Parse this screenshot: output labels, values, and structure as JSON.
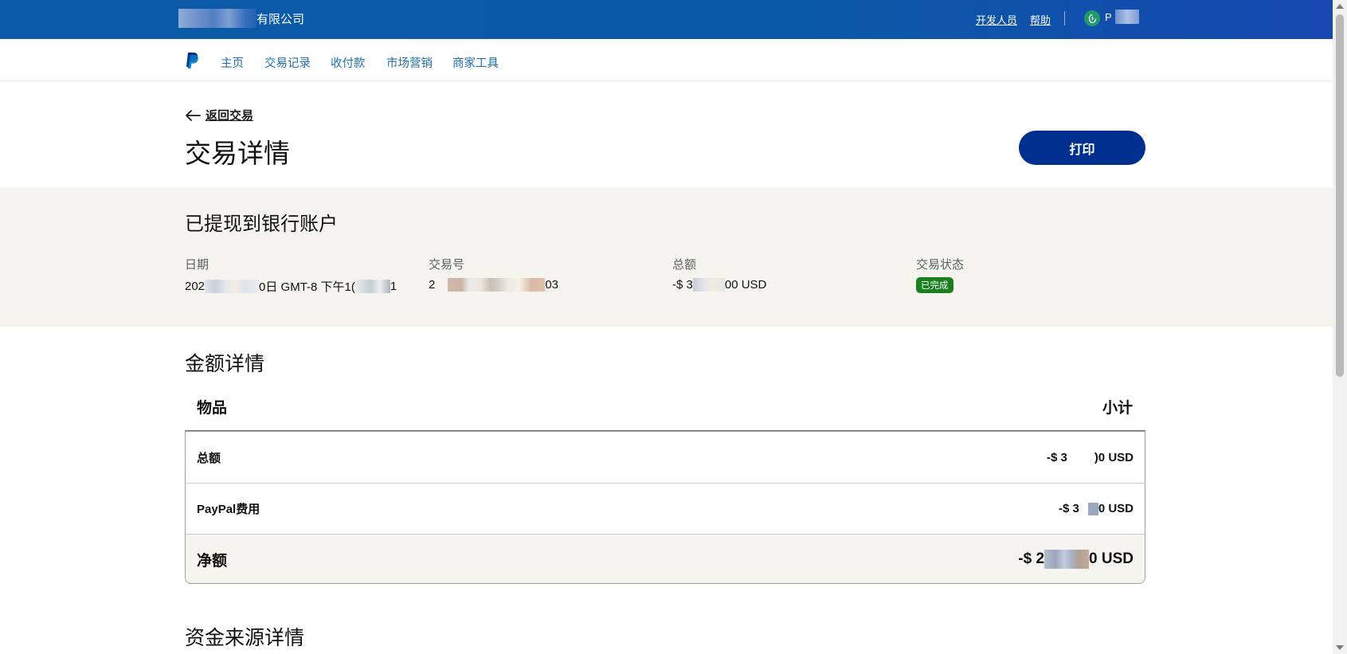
{
  "topbar": {
    "company_suffix": "有限公司",
    "links": {
      "developer": "开发人员",
      "help": "帮助"
    },
    "user_initial": "P"
  },
  "nav": {
    "items": [
      "主页",
      "交易记录",
      "收付款",
      "市场营销",
      "商家工具"
    ]
  },
  "header": {
    "back_label": "返回交易",
    "title": "交易详情",
    "print_label": "打印"
  },
  "summary": {
    "title": "已提现到银行账户",
    "date": {
      "label": "日期",
      "prefix": "202",
      "mid": "0日 GMT-8 下午1(",
      "suffix": "1"
    },
    "txn_id": {
      "label": "交易号",
      "prefix": "2",
      "suffix": "03"
    },
    "total": {
      "label": "总额",
      "prefix": "-$ 3",
      "suffix": "00 USD"
    },
    "status": {
      "label": "交易状态",
      "value": "已完成"
    }
  },
  "amount_details": {
    "title": "金额详情",
    "col_item": "物品",
    "col_subtotal": "小计",
    "rows": [
      {
        "label": "总额",
        "amount_prefix": "-$ 3",
        "amount_suffix": ")0 USD"
      },
      {
        "label": "PayPal费用",
        "amount_prefix": "-$ 3",
        "amount_suffix": "0 USD"
      },
      {
        "label": "净额",
        "amount_prefix": "-$ 2",
        "amount_suffix": "0 USD"
      }
    ]
  },
  "funding": {
    "title": "资金来源详情"
  },
  "colors": {
    "topbar": "#0a5aa8",
    "nav_link": "#1f6fb2",
    "primary_button": "#00308f",
    "band_bg": "#f5f4ef",
    "status_green": "#1a7f1e"
  },
  "icons": [
    "back-arrow-icon",
    "paypal-logo-icon",
    "user-avatar-icon"
  ]
}
